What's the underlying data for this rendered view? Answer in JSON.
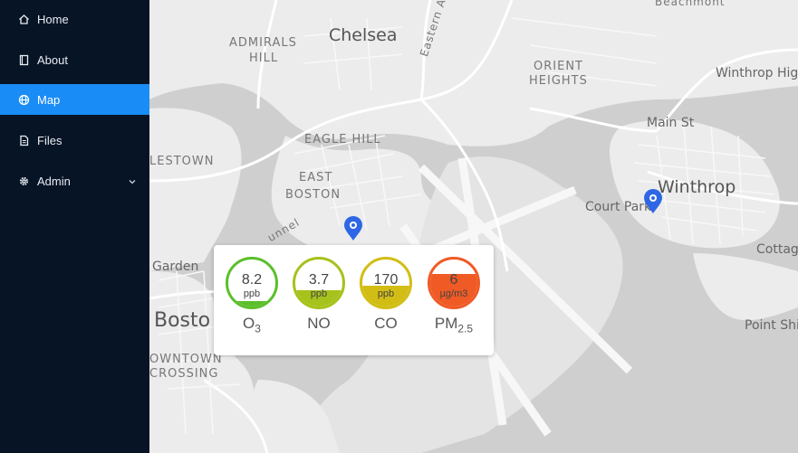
{
  "sidebar": {
    "items": [
      {
        "label": "Home",
        "icon": "home-icon"
      },
      {
        "label": "About",
        "icon": "book-icon"
      },
      {
        "label": "Map",
        "icon": "globe-icon",
        "active": true
      },
      {
        "label": "Files",
        "icon": "file-icon"
      },
      {
        "label": "Admin",
        "icon": "gear-icon",
        "has_submenu": true
      }
    ],
    "bg_color": "#071425",
    "active_color": "#1a8cf5"
  },
  "map": {
    "labels": {
      "chelsea": "Chelsea",
      "eastern_av": "Eastern Av",
      "admirals_hill_1": "ADMIRALS",
      "admirals_hill_2": "HILL",
      "orient_heights_1": "ORIENT",
      "orient_heights_2": "HEIGHTS",
      "winthrop_highlands": "Winthrop Highl",
      "main_st": "Main St",
      "eagle_hill": "EAGLE HILL",
      "east_boston_1": "EAST",
      "east_boston_2": "BOSTON",
      "charlestown": "LESTOWN",
      "winthrop": "Winthrop",
      "court_park": "Court Park",
      "tunnel": "unnel",
      "garden": "Garden",
      "cottage": "Cottage",
      "boston": "Bosto",
      "downtown_crossing_1": "OWNTOWN",
      "downtown_crossing_2": "CROSSING",
      "point_shirley": "Point Shir",
      "beachmont": "Beachmont"
    }
  },
  "popup": {
    "gauges": [
      {
        "value": "8.2",
        "unit": "ppb",
        "label": "O",
        "sub": "3",
        "level": 0.12,
        "color": "#5bbf2a"
      },
      {
        "value": "3.7",
        "unit": "ppb",
        "label": "NO",
        "sub": "",
        "level": 0.35,
        "color": "#a6c21c"
      },
      {
        "value": "170",
        "unit": "ppb",
        "label": "CO",
        "sub": "",
        "level": 0.45,
        "color": "#d2bd14"
      },
      {
        "value": "6",
        "unit": "µg/m3",
        "label": "PM",
        "sub": "2.5",
        "level": 0.7,
        "color": "#f05a25"
      }
    ]
  }
}
